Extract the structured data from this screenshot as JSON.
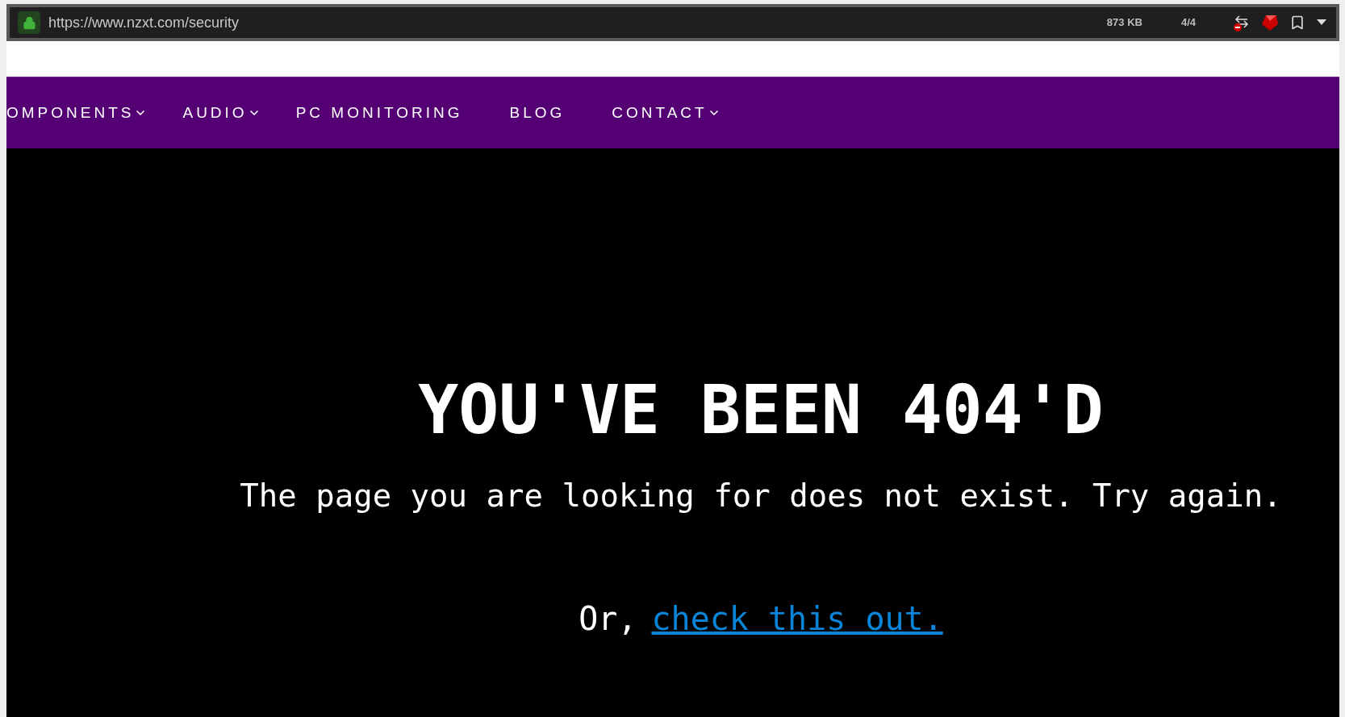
{
  "browser": {
    "url": "https://www.nzxt.com/security",
    "page_size": "873 KB",
    "counter": "4/4"
  },
  "nav": [
    {
      "label": "OMPONENTS",
      "dropdown": true
    },
    {
      "label": "AUDIO",
      "dropdown": true
    },
    {
      "label": "PC MONITORING",
      "dropdown": false
    },
    {
      "label": "BLOG",
      "dropdown": false
    },
    {
      "label": "CONTACT",
      "dropdown": true
    }
  ],
  "error": {
    "title": "YOU'VE BEEN 404'D",
    "message": "The page you are looking for does not exist. Try again.",
    "prefix": "Or,",
    "link": "check this out."
  }
}
